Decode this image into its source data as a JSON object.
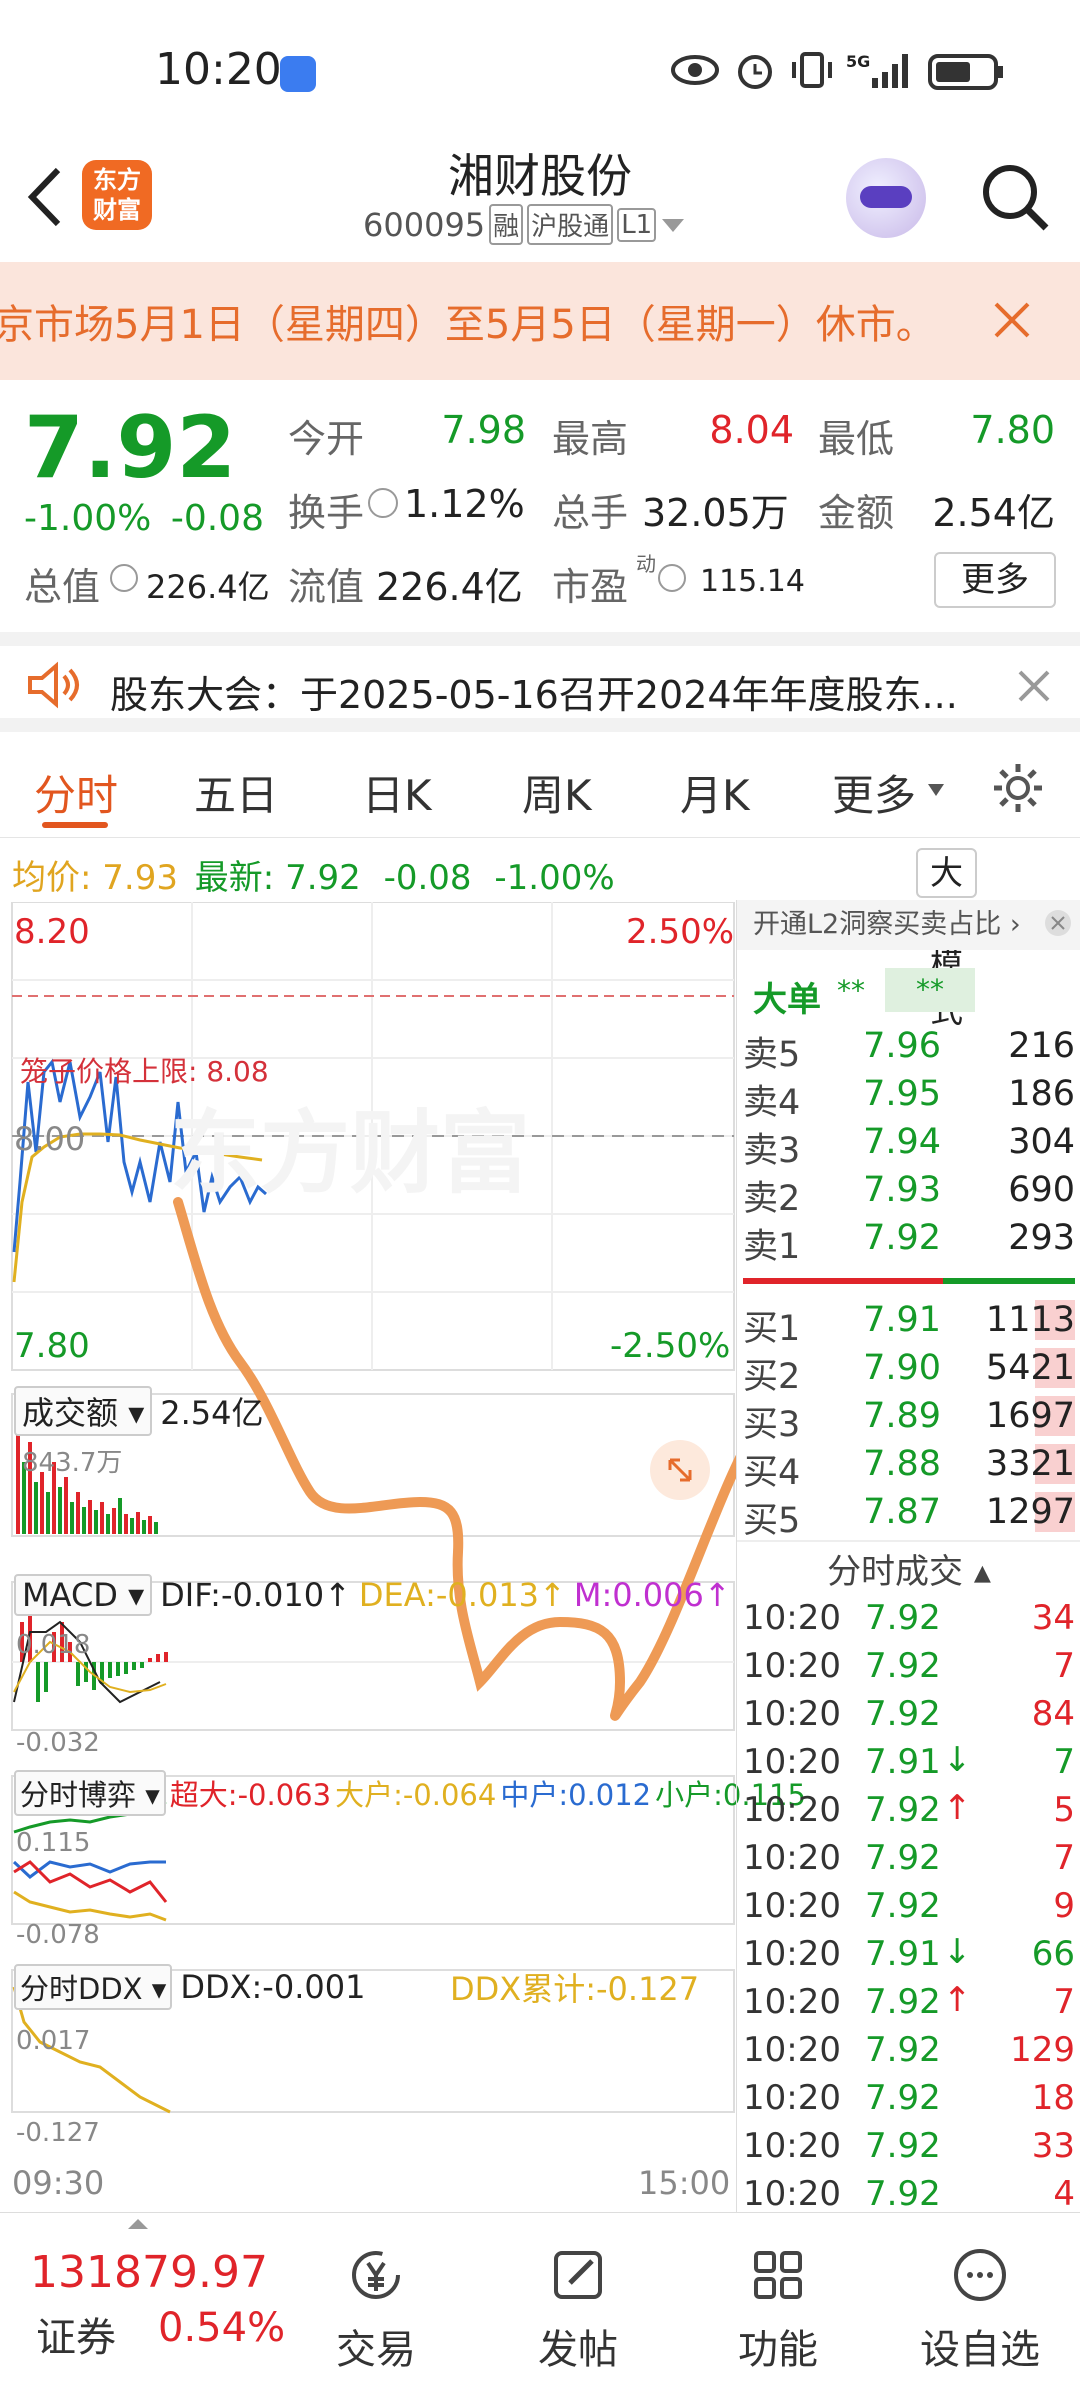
{
  "status_bar": {
    "time": "10:20",
    "network": "5G"
  },
  "header": {
    "title": "湘财股份",
    "code": "600095",
    "tags": [
      "融",
      "沪股通",
      "L1"
    ],
    "logo_text_1": "东方",
    "logo_text_2": "财富"
  },
  "notice": {
    "text": "京市场5月1日（星期四）至5月5日（星期一）休市。"
  },
  "quote": {
    "price": "7.92",
    "change_pct": "-1.00%",
    "change": "-0.08",
    "open_label": "今开",
    "open": "7.98",
    "high_label": "最高",
    "high": "8.04",
    "low_label": "最低",
    "low": "7.80",
    "turnover_label": "换手",
    "turnover": "1.12%",
    "volume_label": "总手",
    "volume": "32.05万",
    "amount_label": "金额",
    "amount": "2.54亿",
    "mcap_label": "总值",
    "mcap": "226.4亿",
    "float_label": "流值",
    "float": "226.4亿",
    "pe_label": "市盈",
    "pe_sup": "动",
    "pe": "115.14",
    "more": "更多"
  },
  "announcement": {
    "text": "股东大会：于2025-05-16召开2024年年度股东..."
  },
  "tabs": [
    "分时",
    "五日",
    "日K",
    "周K",
    "月K",
    "更多"
  ],
  "chart": {
    "avg_label": "均价:",
    "avg": "7.93",
    "latest_label": "最新:",
    "latest": "7.92",
    "latest_chg": "-0.08",
    "latest_pct": "-1.00%",
    "big_order_mode": "大单模式",
    "price_top": "8.20",
    "pct_top": "2.50%",
    "limit_label": "笼子价格上限:",
    "limit": "8.08",
    "ref_price": "8.00",
    "price_bottom": "7.80",
    "pct_bottom": "-2.50%",
    "watermark": "东方财富",
    "vol_label": "成交额",
    "vol_total": "2.54亿",
    "vol_max": "843.7万",
    "macd_label": "MACD",
    "dif": "DIF:-0.010↑",
    "dea": "DEA:-0.013↑",
    "m": "M:0.006↑",
    "macd_top": "0.018",
    "macd_bottom": "-0.032",
    "bo_label": "分时博弈",
    "bo_super": "超大:-0.063",
    "bo_big": "大户:-0.064",
    "bo_mid": "中户:0.012",
    "bo_small": "小户:0.115",
    "bo_top": "0.115",
    "bo_bottom": "-0.078",
    "ddx_label": "分时DDX",
    "ddx": "DDX:-0.001",
    "ddx_cum": "DDX累计:-0.127",
    "ddx_top": "0.017",
    "ddx_bottom": "-0.127",
    "time_start": "09:30",
    "time_end": "15:00"
  },
  "orderbook": {
    "promo": "开通L2洞察买卖占比",
    "big_label": "大单",
    "big_v1": "**",
    "big_v2": "**",
    "asks": [
      {
        "label": "卖5",
        "price": "7.96",
        "vol": "216"
      },
      {
        "label": "卖4",
        "price": "7.95",
        "vol": "186"
      },
      {
        "label": "卖3",
        "price": "7.94",
        "vol": "304"
      },
      {
        "label": "卖2",
        "price": "7.93",
        "vol": "690"
      },
      {
        "label": "卖1",
        "price": "7.92",
        "vol": "293"
      }
    ],
    "bids": [
      {
        "label": "买1",
        "price": "7.91",
        "vol": "1113"
      },
      {
        "label": "买2",
        "price": "7.90",
        "vol": "5421"
      },
      {
        "label": "买3",
        "price": "7.89",
        "vol": "1697"
      },
      {
        "label": "买4",
        "price": "7.88",
        "vol": "3321"
      },
      {
        "label": "买5",
        "price": "7.87",
        "vol": "1297"
      }
    ],
    "ticks_title": "分时成交",
    "ticks": [
      {
        "t": "10:20",
        "p": "7.92",
        "a": "",
        "v": "34"
      },
      {
        "t": "10:20",
        "p": "7.92",
        "a": "",
        "v": "7"
      },
      {
        "t": "10:20",
        "p": "7.92",
        "a": "",
        "v": "84"
      },
      {
        "t": "10:20",
        "p": "7.91",
        "a": "↓",
        "v": "7"
      },
      {
        "t": "10:20",
        "p": "7.92",
        "a": "↑",
        "v": "5"
      },
      {
        "t": "10:20",
        "p": "7.92",
        "a": "",
        "v": "7"
      },
      {
        "t": "10:20",
        "p": "7.92",
        "a": "",
        "v": "9"
      },
      {
        "t": "10:20",
        "p": "7.91",
        "a": "↓",
        "v": "66"
      },
      {
        "t": "10:20",
        "p": "7.92",
        "a": "↑",
        "v": "7"
      },
      {
        "t": "10:20",
        "p": "7.92",
        "a": "",
        "v": "129"
      },
      {
        "t": "10:20",
        "p": "7.92",
        "a": "",
        "v": "18"
      },
      {
        "t": "10:20",
        "p": "7.92",
        "a": "",
        "v": "33"
      },
      {
        "t": "10:20",
        "p": "7.92",
        "a": "",
        "v": "4"
      }
    ]
  },
  "bottom_nav": {
    "index_value": "131879.97",
    "index_name": "证券",
    "index_pct": "0.54%",
    "items": [
      "交易",
      "发帖",
      "功能",
      "设自选"
    ]
  }
}
